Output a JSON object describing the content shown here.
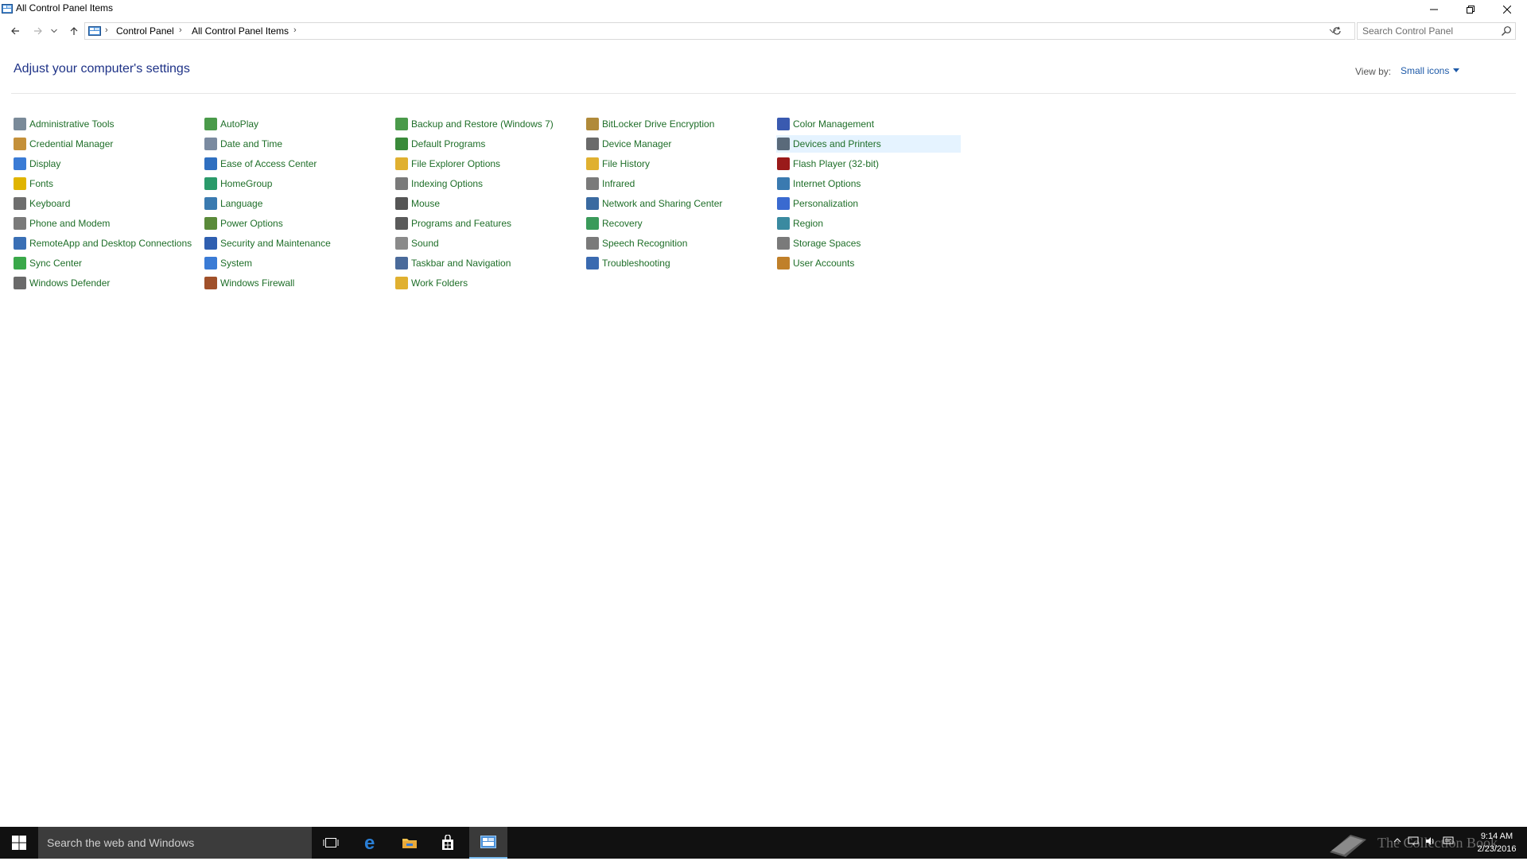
{
  "window": {
    "title": "All Control Panel Items"
  },
  "address": {
    "crumbs": [
      "Control Panel",
      "All Control Panel Items"
    ]
  },
  "search": {
    "placeholder": "Search Control Panel"
  },
  "content": {
    "heading": "Adjust your computer's settings",
    "view_by_label": "View by:",
    "view_by_value": "Small icons",
    "columns": [
      [
        {
          "label": "Administrative Tools",
          "icon": "admin-tools-icon",
          "color": "#7a8a99"
        },
        {
          "label": "Credential Manager",
          "icon": "credential-manager-icon",
          "color": "#c4903a"
        },
        {
          "label": "Display",
          "icon": "display-icon",
          "color": "#3a7bd5"
        },
        {
          "label": "Fonts",
          "icon": "fonts-icon",
          "color": "#e0b400"
        },
        {
          "label": "Keyboard",
          "icon": "keyboard-icon",
          "color": "#6e6e6e"
        },
        {
          "label": "Phone and Modem",
          "icon": "phone-modem-icon",
          "color": "#7a7a7a"
        },
        {
          "label": "RemoteApp and Desktop Connections",
          "icon": "remoteapp-icon",
          "color": "#3a6fb5"
        },
        {
          "label": "Sync Center",
          "icon": "sync-center-icon",
          "color": "#3aa84a"
        },
        {
          "label": "Windows Defender",
          "icon": "windows-defender-icon",
          "color": "#6a6a6a"
        }
      ],
      [
        {
          "label": "AutoPlay",
          "icon": "autoplay-icon",
          "color": "#4a9a4a"
        },
        {
          "label": "Date and Time",
          "icon": "date-time-icon",
          "color": "#7a8aa0"
        },
        {
          "label": "Ease of Access Center",
          "icon": "ease-of-access-icon",
          "color": "#2f6fc0"
        },
        {
          "label": "HomeGroup",
          "icon": "homegroup-icon",
          "color": "#2a9a6a"
        },
        {
          "label": "Language",
          "icon": "language-icon",
          "color": "#3a7ab0"
        },
        {
          "label": "Power Options",
          "icon": "power-options-icon",
          "color": "#5a8a3a"
        },
        {
          "label": "Security and Maintenance",
          "icon": "security-maintenance-icon",
          "color": "#2f5fb0"
        },
        {
          "label": "System",
          "icon": "system-icon",
          "color": "#3a7bd5"
        },
        {
          "label": "Windows Firewall",
          "icon": "windows-firewall-icon",
          "color": "#a0502a"
        }
      ],
      [
        {
          "label": "Backup and Restore (Windows 7)",
          "icon": "backup-restore-icon",
          "color": "#4a9a4a"
        },
        {
          "label": "Default Programs",
          "icon": "default-programs-icon",
          "color": "#3a8a3a"
        },
        {
          "label": "File Explorer Options",
          "icon": "file-explorer-options-icon",
          "color": "#e0b030"
        },
        {
          "label": "Indexing Options",
          "icon": "indexing-options-icon",
          "color": "#7a7a7a"
        },
        {
          "label": "Mouse",
          "icon": "mouse-icon",
          "color": "#555555"
        },
        {
          "label": "Programs and Features",
          "icon": "programs-features-icon",
          "color": "#5a5a5a"
        },
        {
          "label": "Sound",
          "icon": "sound-icon",
          "color": "#8a8a8a"
        },
        {
          "label": "Taskbar and Navigation",
          "icon": "taskbar-navigation-icon",
          "color": "#4a6a9a"
        },
        {
          "label": "Work Folders",
          "icon": "work-folders-icon",
          "color": "#e0b030"
        }
      ],
      [
        {
          "label": "BitLocker Drive Encryption",
          "icon": "bitlocker-icon",
          "color": "#b08a3a"
        },
        {
          "label": "Device Manager",
          "icon": "device-manager-icon",
          "color": "#6a6a6a"
        },
        {
          "label": "File History",
          "icon": "file-history-icon",
          "color": "#e0b030"
        },
        {
          "label": "Infrared",
          "icon": "infrared-icon",
          "color": "#7a7a7a"
        },
        {
          "label": "Network and Sharing Center",
          "icon": "network-sharing-icon",
          "color": "#3a6aa0"
        },
        {
          "label": "Recovery",
          "icon": "recovery-icon",
          "color": "#3a9a5a"
        },
        {
          "label": "Speech Recognition",
          "icon": "speech-recognition-icon",
          "color": "#7a7a7a"
        },
        {
          "label": "Troubleshooting",
          "icon": "troubleshooting-icon",
          "color": "#3a6ab0"
        }
      ],
      [
        {
          "label": "Color Management",
          "icon": "color-management-icon",
          "color": "#3a5ab0"
        },
        {
          "label": "Devices and Printers",
          "icon": "devices-printers-icon",
          "color": "#5a6a7a"
        },
        {
          "label": "Flash Player (32-bit)",
          "icon": "flash-player-icon",
          "color": "#9a1a1a"
        },
        {
          "label": "Internet Options",
          "icon": "internet-options-icon",
          "color": "#3a7ab0"
        },
        {
          "label": "Personalization",
          "icon": "personalization-icon",
          "color": "#3a6ad0"
        },
        {
          "label": "Region",
          "icon": "region-icon",
          "color": "#3a8aa0"
        },
        {
          "label": "Storage Spaces",
          "icon": "storage-spaces-icon",
          "color": "#7a7a7a"
        },
        {
          "label": "User Accounts",
          "icon": "user-accounts-icon",
          "color": "#c0802a"
        }
      ]
    ],
    "hovered_item": "Devices and Printers"
  },
  "taskbar": {
    "search_placeholder": "Search the web and Windows",
    "clock_time": "9:14 AM",
    "clock_date": "2/23/2016",
    "watermark": "The Collection Book"
  },
  "colors": {
    "link": "#1e6e28",
    "heading": "#1e3287",
    "hover": "#e5f3ff",
    "taskbar": "#111111"
  }
}
